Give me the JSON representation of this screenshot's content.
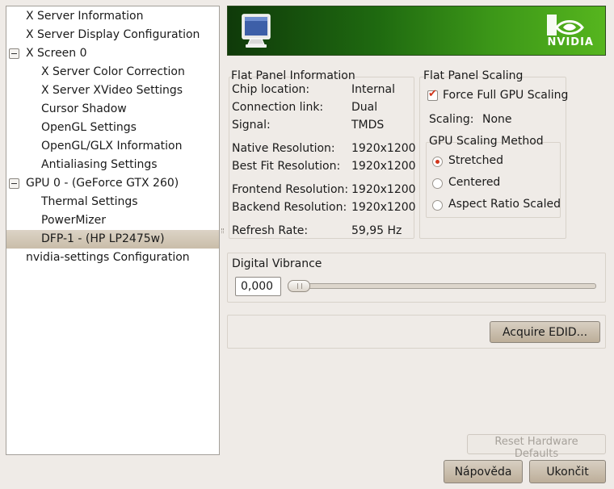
{
  "tree": {
    "items": [
      {
        "label": "X Server Information"
      },
      {
        "label": "X Server Display Configuration"
      },
      {
        "label": "X Screen 0",
        "expander": "collapse-icon"
      },
      {
        "label": "X Server Color Correction"
      },
      {
        "label": "X Server XVideo Settings"
      },
      {
        "label": "Cursor Shadow"
      },
      {
        "label": "OpenGL Settings"
      },
      {
        "label": "OpenGL/GLX Information"
      },
      {
        "label": "Antialiasing Settings"
      },
      {
        "label": "GPU 0 - (GeForce GTX 260)",
        "expander": "collapse-icon"
      },
      {
        "label": "Thermal Settings"
      },
      {
        "label": "PowerMizer"
      },
      {
        "label": "DFP-1 - (HP LP2475w)",
        "selected": true
      },
      {
        "label": "nvidia-settings Configuration"
      }
    ]
  },
  "banner": {
    "icon": "monitor-icon",
    "logo": "nvidia-logo-icon",
    "logo_text": "NVIDIA",
    "colors": {
      "dark": "#0f3a0a",
      "light": "#56b51e"
    }
  },
  "flat_panel_info": {
    "title": "Flat Panel Information",
    "rows": [
      {
        "label": "Chip location:",
        "value": "Internal"
      },
      {
        "label": "Connection link:",
        "value": "Dual"
      },
      {
        "label": "Signal:",
        "value": "TMDS"
      },
      {
        "label": "Native Resolution:",
        "value": "1920x1200"
      },
      {
        "label": "Best Fit Resolution:",
        "value": "1920x1200"
      },
      {
        "label": "Frontend Resolution:",
        "value": "1920x1200"
      },
      {
        "label": "Backend Resolution:",
        "value": "1920x1200"
      },
      {
        "label": "Refresh Rate:",
        "value": "59,95 Hz"
      }
    ]
  },
  "flat_panel_scaling": {
    "title": "Flat Panel Scaling",
    "force_full_gpu_scaling": {
      "label": "Force Full GPU Scaling",
      "checked": true
    },
    "scaling_label": "Scaling:",
    "scaling_value": "None",
    "method": {
      "title": "GPU Scaling Method",
      "options": [
        {
          "label": "Stretched",
          "selected": true
        },
        {
          "label": "Centered",
          "selected": false
        },
        {
          "label": "Aspect Ratio Scaled",
          "selected": false
        }
      ]
    }
  },
  "digital_vibrance": {
    "title": "Digital Vibrance",
    "value": "0,000",
    "level": 0
  },
  "buttons": {
    "acquire_edid": "Acquire EDID...",
    "reset_defaults": "Reset Hardware Defaults",
    "help": "Nápověda",
    "quit": "Ukončit"
  },
  "colors": {
    "accent": "#d1351b",
    "selection": "#c9bda9"
  }
}
